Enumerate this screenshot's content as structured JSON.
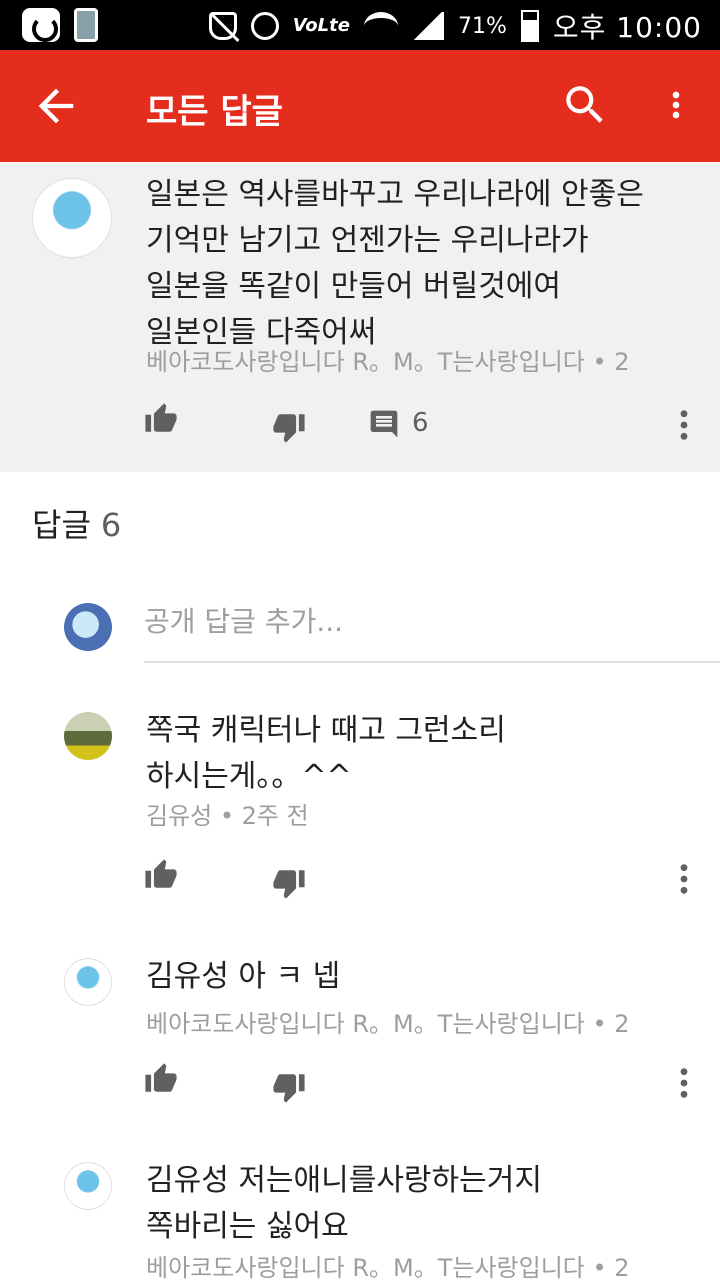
{
  "status_bar": {
    "battery": "71%",
    "time": "오후 10:00",
    "volte": "VoLte"
  },
  "app_bar": {
    "title": "모든 답글"
  },
  "top_comment": {
    "text": "일본은 역사를바꾸고 우리나라에 안좋은\n기억만 남기고 언젠가는 우리나라가\n일본을 똑같이 만들어 버릴것에여\n일본인들 다죽어써",
    "meta": "베아코도사랑입니다 R。M。T는사랑입니다 • 2",
    "reply_count": "6"
  },
  "replies_section": {
    "label": "답글",
    "count": "6"
  },
  "reply_input": {
    "placeholder": "공개 답글 추가..."
  },
  "replies": [
    {
      "text": "쪽국 캐릭터나 때고 그런소리\n하시는게。。^^",
      "meta": "김유성 • 2주 전"
    },
    {
      "text": "김유성 아 ㅋ 넵",
      "meta": "베아코도사랑입니다 R。M。T는사랑입니다 • 2"
    },
    {
      "text": "김유성 저는애니를사랑하는거지\n쪽바리는 싫어요",
      "meta": "베아코도사랑입니다 R。M。T는사랑입니다 • 2"
    }
  ],
  "colors": {
    "app_bar": "#e52d1e",
    "top_comment_bg": "#f1f1f1",
    "meta_text": "#9e9e9e"
  }
}
